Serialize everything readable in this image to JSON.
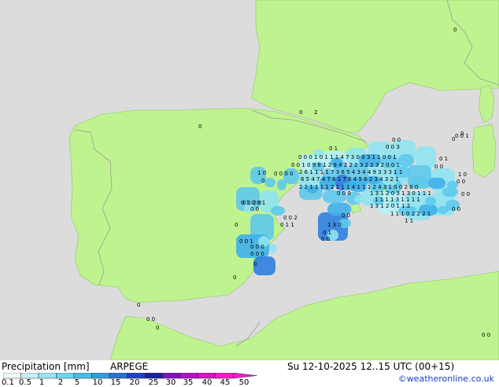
{
  "map": {
    "sea_color": "#dcdcdc",
    "land_color": "#bff38f",
    "border_color": "#9a9a9a",
    "precip_cells": [
      {
        "a": "0",
        "c": "#b6f0f6"
      },
      {
        "a": "0",
        "c": "#b6f0f6"
      },
      {
        "a": "1",
        "c": "#8fe3f1"
      },
      {
        "a": "0",
        "c": "#8fe3f1"
      },
      {
        "a": "1",
        "c": "#8fe3f1"
      },
      {
        "a": "1",
        "c": "#8fe3f1"
      },
      {
        "a": "1",
        "c": "#8fe3f1"
      },
      {
        "a": "4",
        "c": "#5ec9ec"
      },
      {
        "a": "7",
        "c": "#5ec9ec"
      },
      {
        "a": "3",
        "c": "#5ec9ec"
      },
      {
        "a": "0",
        "c": "#8fe3f1"
      },
      {
        "a": "0",
        "c": "#8fe3f1"
      },
      {
        "a": "3",
        "c": "#5ec9ec"
      },
      {
        "a": "1",
        "c": "#8fe3f1"
      },
      {
        "a": "1",
        "c": "#8fe3f1"
      },
      {
        "a": "0",
        "c": "#8fe3f1"
      },
      {
        "a": "0",
        "c": "#b6f0f6"
      },
      {
        "a": "1",
        "c": "#8fe3f1"
      },
      {
        "a": "9",
        "c": "#3fb0ea"
      },
      {
        "a": "8",
        "c": "#3fb0ea"
      },
      {
        "a": "12",
        "c": "#2d7fe0"
      },
      {
        "a": "9",
        "c": "#3fb0ea"
      },
      {
        "a": "4",
        "c": "#5ec9ec"
      },
      {
        "a": "2",
        "c": "#5ec9ec"
      },
      {
        "a": "2",
        "c": "#5ec9ec"
      },
      {
        "a": "2",
        "c": "#5ec9ec"
      },
      {
        "a": "3",
        "c": "#5ec9ec"
      },
      {
        "a": "2",
        "c": "#5ec9ec"
      },
      {
        "a": "2",
        "c": "#5ec9ec"
      },
      {
        "a": "0",
        "c": "#8fe3f1"
      },
      {
        "a": "2",
        "c": "#5ec9ec"
      },
      {
        "a": "6",
        "c": "#3fb0ea"
      },
      {
        "a": "11",
        "c": "#2d7fe0"
      },
      {
        "a": "11",
        "c": "#2d7fe0"
      },
      {
        "a": "7",
        "c": "#3fb0ea"
      },
      {
        "a": "3",
        "c": "#5ec9ec"
      },
      {
        "a": "6",
        "c": "#3fb0ea"
      },
      {
        "a": "5",
        "c": "#5ec9ec"
      },
      {
        "a": "4",
        "c": "#5ec9ec"
      },
      {
        "a": "3",
        "c": "#5ec9ec"
      },
      {
        "a": "4",
        "c": "#5ec9ec"
      },
      {
        "a": "6",
        "c": "#3fb0ea"
      },
      {
        "a": "5",
        "c": "#5ec9ec"
      },
      {
        "a": "4",
        "c": "#5ec9ec"
      },
      {
        "a": "7",
        "c": "#3fb0ea"
      },
      {
        "a": "5",
        "c": "#5ec9ec"
      },
      {
        "a": "1",
        "c": "#8fe3f1"
      },
      {
        "a": "7",
        "c": "#3fb0ea"
      },
      {
        "a": "8",
        "c": "#3fb0ea"
      },
      {
        "a": "5",
        "c": "#5ec9ec"
      },
      {
        "a": "6",
        "c": "#3fb0ea"
      },
      {
        "a": "2",
        "c": "#5ec9ec"
      },
      {
        "a": "2",
        "c": "#5ec9ec"
      },
      {
        "a": "2",
        "c": "#5ec9ec"
      },
      {
        "a": "1",
        "c": "#8fe3f1"
      },
      {
        "a": "1",
        "c": "#8fe3f1"
      },
      {
        "a": "1",
        "c": "#8fe3f1"
      },
      {
        "a": "1",
        "c": "#8fe3f1"
      },
      {
        "a": "2",
        "c": "#5ec9ec"
      },
      {
        "a": "1",
        "c": "#8fe3f1"
      },
      {
        "a": "4",
        "c": "#5ec9ec"
      },
      {
        "a": "0",
        "c": "#8fe3f1"
      },
      {
        "a": "1",
        "c": "#8fe3f1"
      },
      {
        "a": "2",
        "c": "#5ec9ec"
      },
      {
        "a": "4",
        "c": "#5ec9ec"
      },
      {
        "a": "3",
        "c": "#5ec9ec"
      },
      {
        "a": "1",
        "c": "#8fe3f1"
      }
    ],
    "precip_labels": [
      {
        "t": "0 1"
      },
      {
        "t": "0 0 0 1 0 1 1 1 4 7 3 0 0 3 1 1 0 0 1"
      },
      {
        "t": "0 0 1 0 9 8 1 2 9 4 2 2 2 3 2 2 3 2 0 0 1"
      },
      {
        "t": "2 6 1 1 1 1 7 3 6 5 4 3 4 4 9 3 3 3 1 1"
      },
      {
        "t": "6 5 4 7 4 7 6 1 7 8 4 5 6 2 3 4 3 2 1"
      },
      {
        "t": "2 2 1 1 1 1 2 2 1 1 4 1 1 1 2 4 3 1 0 0 2 0 0"
      },
      {
        "t": "1 3 1 2 0 3 1 3 0 1 1 1"
      },
      {
        "t": "1 0"
      },
      {
        "t": "0 0 0 0"
      },
      {
        "t": "0 0"
      },
      {
        "t": "0 0 3"
      },
      {
        "t": "0 0 1"
      },
      {
        "t": "1 1 1 1 3 1 1 1 1"
      },
      {
        "t": "1 3 1 2 0 1 1 2"
      },
      {
        "t": "1 1 1 0 2 2 2 1"
      },
      {
        "t": "1 1"
      },
      {
        "t": "0 1"
      },
      {
        "t": "0 0"
      },
      {
        "t": "1 0"
      },
      {
        "t": "0 0"
      },
      {
        "t": "0 0"
      },
      {
        "t": "0 1 2 0"
      },
      {
        "t": "0 0 2"
      },
      {
        "t": "0 1 1"
      },
      {
        "t": "1 3 0"
      },
      {
        "t": "0 1"
      },
      {
        "t": "0 0 1"
      },
      {
        "t": "0 1 0 0 1"
      },
      {
        "t": "0 0"
      },
      {
        "t": "0 0 0"
      },
      {
        "t": "0 0 0"
      },
      {
        "t": "0"
      },
      {
        "t": "0"
      },
      {
        "t": "2"
      },
      {
        "t": "0 0"
      },
      {
        "t": "0 0"
      },
      {
        "t": "0"
      },
      {
        "t": "0"
      },
      {
        "t": "0"
      },
      {
        "t": "0"
      },
      {
        "t": "0"
      },
      {
        "t": "0 0"
      },
      {
        "t": "0"
      },
      {
        "t": "0 0"
      },
      {
        "t": "0 0"
      },
      {
        "t": "0"
      },
      {
        "t": "0 0 0"
      },
      {
        "t": "0"
      },
      {
        "t": "0"
      }
    ]
  },
  "legend": {
    "title": "Precipitation [mm]",
    "model": "ARPEGE",
    "scale": [
      {
        "c": "#f2fbfd"
      },
      {
        "c": "#c6eef8"
      },
      {
        "c": "#9ae3f3"
      },
      {
        "c": "#6ed3ee"
      },
      {
        "c": "#45bde6"
      },
      {
        "c": "#2f9fdd"
      },
      {
        "c": "#2a6fd1"
      },
      {
        "c": "#2343bd"
      },
      {
        "c": "#1b1fa3"
      },
      {
        "c": "#7f12bd"
      },
      {
        "c": "#ad12c9"
      },
      {
        "c": "#cf16c4"
      },
      {
        "c": "#ee1ec9"
      }
    ],
    "ticks": [
      "0.1",
      "0.5",
      "1",
      "2",
      "5",
      "10",
      "15",
      "20",
      "25",
      "30",
      "35",
      "40",
      "45",
      "50"
    ]
  },
  "datetime": "Su 12-10-2025 12..15 UTC (00+15)",
  "credit": "©weatheronline.co.uk"
}
